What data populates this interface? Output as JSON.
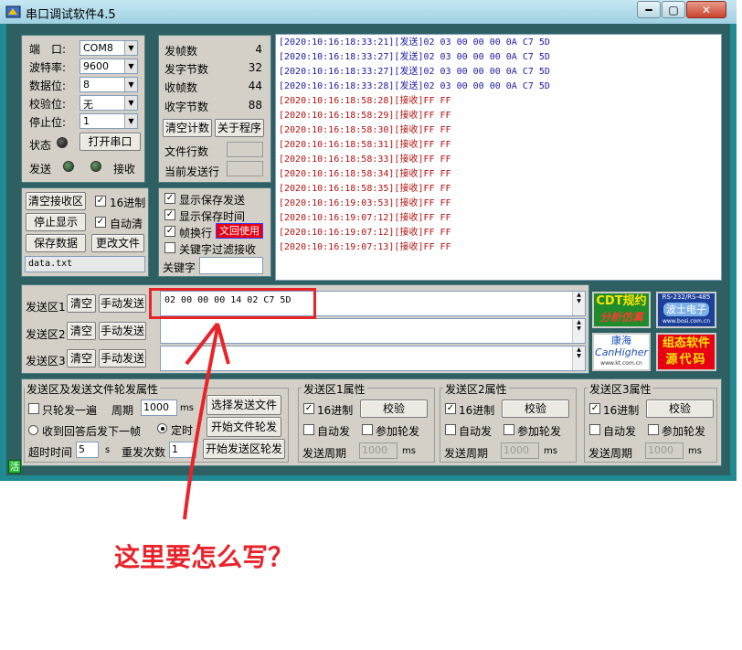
{
  "window": {
    "title": "串口调试软件4.5",
    "controls": {
      "minimize": "━",
      "maximize": "▢",
      "close": "✕"
    }
  },
  "port": {
    "port_label": "端　口:",
    "port_value": "COM8",
    "baud_label": "波特率:",
    "baud_value": "9600",
    "data_label": "数据位:",
    "data_value": "8",
    "parity_label": "校验位:",
    "parity_value": "无",
    "stop_label": "停止位:",
    "stop_value": "1",
    "status_label": "状态",
    "open_button": "打开串口",
    "send_label": "发送",
    "recv_label": "接收"
  },
  "counters": {
    "send_frames_label": "发帧数",
    "send_frames": "4",
    "send_bytes_label": "发字节数",
    "send_bytes": "32",
    "recv_frames_label": "收帧数",
    "recv_frames": "44",
    "recv_bytes_label": "收字节数",
    "recv_bytes": "88",
    "clear_button": "清空计数",
    "about_button": "关于程序",
    "file_lines_label": "文件行数",
    "current_line_label": "当前发送行"
  },
  "receive": {
    "clear_button": "清空接收区",
    "hex_label": "16进制",
    "stop_button": "停止显示",
    "autoclear_label": "自动清",
    "save_button": "保存数据",
    "change_file_button": "更改文件",
    "filename": "data.txt"
  },
  "options": {
    "show_send": "显示保存发送",
    "show_time": "显示保存时间",
    "frame_newline": "帧换行",
    "frame_badge": "文回使用",
    "keyword_filter": "关键字过滤接收",
    "keyword_label": "关键字"
  },
  "log": [
    {
      "text": "[2020:10:16:18:33:21][发送]02 03 00 00 00 0A C7 5D",
      "kind": "send"
    },
    {
      "text": "[2020:10:16:18:33:27][发送]02 03 00 00 00 0A C7 5D",
      "kind": "send"
    },
    {
      "text": "[2020:10:16:18:33:27][发送]02 03 00 00 00 0A C7 5D",
      "kind": "send"
    },
    {
      "text": "[2020:10:16:18:33:28][发送]02 03 00 00 00 0A C7 5D",
      "kind": "send"
    },
    {
      "text": "[2020:10:16:18:58:28][接收]FF FF",
      "kind": "recv"
    },
    {
      "text": "[2020:10:16:18:58:29][接收]FF FF",
      "kind": "recv"
    },
    {
      "text": "[2020:10:16:18:58:30][接收]FF FF",
      "kind": "recv"
    },
    {
      "text": "[2020:10:16:18:58:31][接收]FF FF",
      "kind": "recv"
    },
    {
      "text": "[2020:10:16:18:58:33][接收]FF FF",
      "kind": "recv"
    },
    {
      "text": "[2020:10:16:18:58:34][接收]FF FF",
      "kind": "recv"
    },
    {
      "text": "[2020:10:16:18:58:35][接收]FF FF",
      "kind": "recv"
    },
    {
      "text": "[2020:10:16:19:03:53][接收]FF FF",
      "kind": "recv"
    },
    {
      "text": "[2020:10:16:19:07:12][接收]FF FF",
      "kind": "recv"
    },
    {
      "text": "[2020:10:16:19:07:12][接收]FF FF",
      "kind": "recv"
    },
    {
      "text": "[2020:10:16:19:07:13][接收]FF FF",
      "kind": "recv"
    }
  ],
  "colors": {
    "send": "#1a1aa6",
    "recv": "#b3120f",
    "annotation": "#e8232a",
    "teal": "#1f8a91"
  },
  "send_areas": [
    {
      "label": "发送区1",
      "clear": "清空",
      "manual": "手动发送",
      "value": "02 00 00 00 14 02 C7 5D"
    },
    {
      "label": "发送区2",
      "clear": "清空",
      "manual": "手动发送",
      "value": ""
    },
    {
      "label": "发送区3",
      "clear": "清空",
      "manual": "手动发送",
      "value": ""
    }
  ],
  "ads": {
    "cdt_line1": "CDT规约",
    "cdt_line2": "分析仿真",
    "bosi_top": "RS-232/RS-485",
    "bosi_name": "波士电子",
    "bosi_url": "www.bosi.com.cn",
    "kh_name": "康海",
    "kh_en": "CanHigher",
    "kh_url": "www.kt.com.cn",
    "zt_line1": "组态软件",
    "zt_line2": "源代码"
  },
  "file_props": {
    "title": "发送区及发送文件轮发属性",
    "only_once": "只轮发一遍",
    "period_label": "周期",
    "period_value": "1000",
    "ms": "ms",
    "select_file": "选择发送文件",
    "after_reply": "收到回答后发下一帧",
    "timed": "定时",
    "start_file": "开始文件轮发",
    "timeout_label": "超时时间",
    "timeout_value": "5",
    "s": "s",
    "repeat_label": "重发次数",
    "repeat_value": "1",
    "start_area": "开始发送区轮发"
  },
  "area_props": [
    {
      "title": "发送区1属性",
      "hex": "16进制",
      "check": "校验",
      "auto": "自动发",
      "poll": "参加轮发",
      "period_label": "发送周期",
      "period_value": "1000",
      "ms": "ms"
    },
    {
      "title": "发送区2属性",
      "hex": "16进制",
      "check": "校验",
      "auto": "自动发",
      "poll": "参加轮发",
      "period_label": "发送周期",
      "period_value": "1000",
      "ms": "ms"
    },
    {
      "title": "发送区3属性",
      "hex": "16进制",
      "check": "校验",
      "auto": "自动发",
      "poll": "参加轮发",
      "period_label": "发送周期",
      "period_value": "1000",
      "ms": "ms"
    }
  ],
  "status_indicator": "活",
  "annotation": {
    "question": "这里要怎么写？"
  }
}
